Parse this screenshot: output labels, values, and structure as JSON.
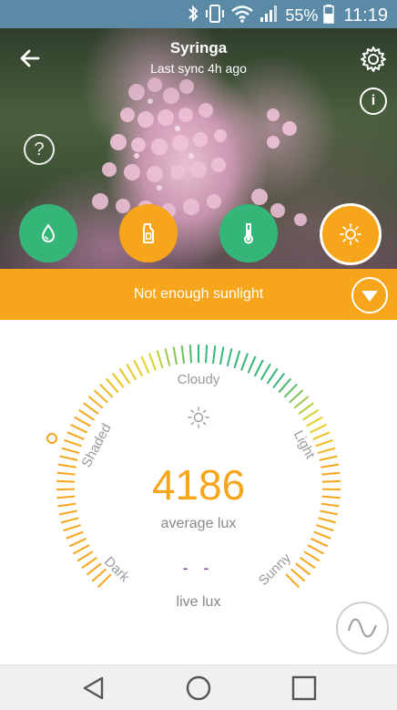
{
  "status_bar": {
    "battery_percent": "55%",
    "time": "11:19",
    "icons": [
      "bluetooth-icon",
      "vibrate-icon",
      "wifi-icon",
      "signal-icon",
      "battery-icon"
    ]
  },
  "header": {
    "title": "Syringa",
    "subtitle": "Last sync 4h ago",
    "icons": [
      "back-arrow-icon",
      "settings-gear-icon",
      "info-icon",
      "help-icon"
    ]
  },
  "sensors": [
    {
      "name": "water",
      "icon": "water-drop-icon",
      "color": "#35b678"
    },
    {
      "name": "fertilizer",
      "icon": "fertilizer-icon",
      "color": "#f7a51b"
    },
    {
      "name": "temperature",
      "icon": "thermometer-icon",
      "color": "#35b678"
    },
    {
      "name": "light",
      "icon": "sun-icon",
      "color": "#f7a51b",
      "active": true
    }
  ],
  "alert": {
    "message": "Not enough sunlight",
    "color": "#f7a51b"
  },
  "gauge": {
    "zones": [
      "Dark",
      "Shaded",
      "Cloudy",
      "Light",
      "Sunny"
    ],
    "average_value": "4186",
    "average_label": "average lux",
    "live_value": "- -",
    "live_label": "live lux",
    "colors": {
      "orange": "#f7a51b",
      "yellow": "#e3d42a",
      "green": "#35b678"
    }
  },
  "nav": {
    "icons": [
      "back-triangle-icon",
      "home-circle-icon",
      "recents-square-icon"
    ]
  }
}
